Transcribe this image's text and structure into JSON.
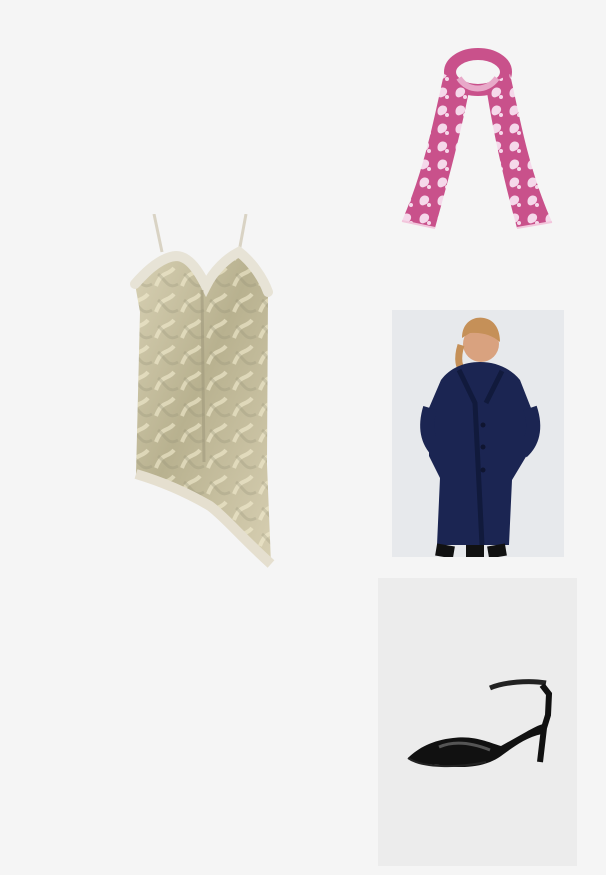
{
  "items": [
    {
      "name": "dress",
      "kind": "lace-trim metallic slip dress",
      "color": "#c9c2a3"
    },
    {
      "name": "scarf",
      "kind": "pink paisley scarf",
      "color": "#c9518b"
    },
    {
      "name": "coat",
      "kind": "navy long wool coat",
      "color": "#1b2552"
    },
    {
      "name": "shoe",
      "kind": "black slingback heel",
      "color": "#111111"
    }
  ]
}
